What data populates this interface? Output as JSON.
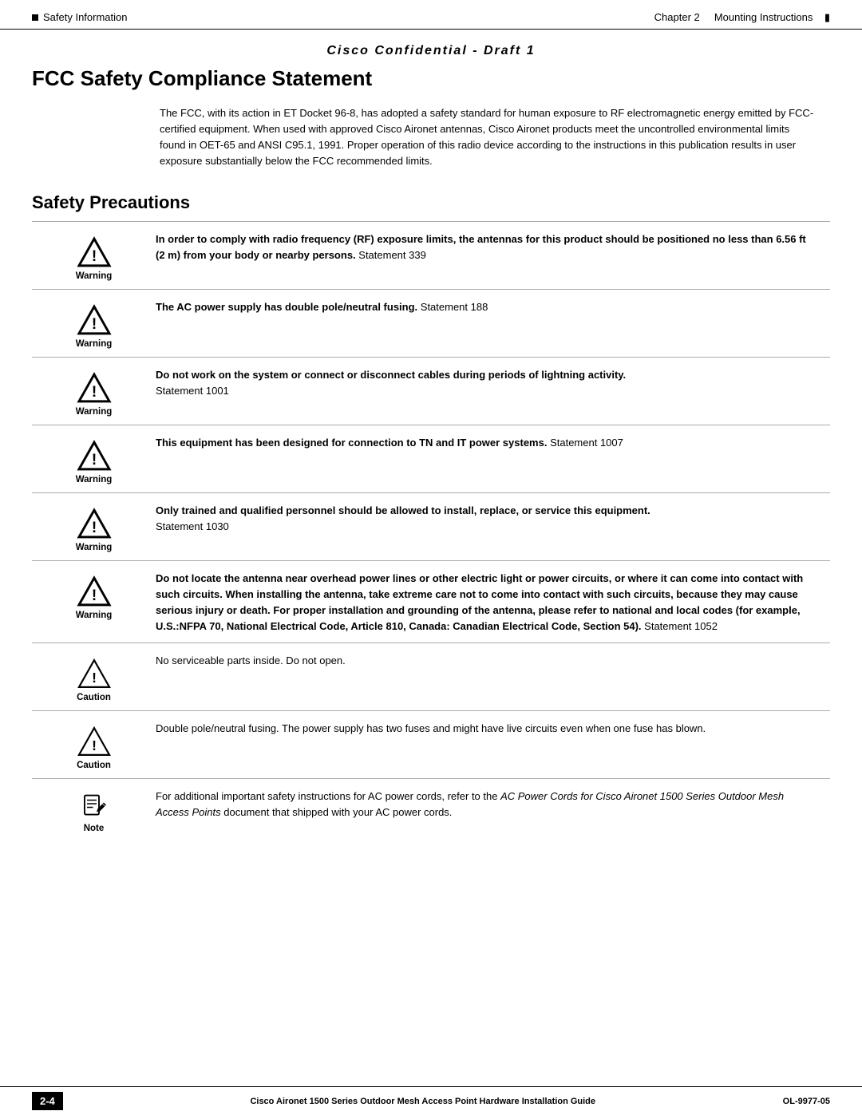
{
  "header": {
    "left_label": "Safety Information",
    "chapter_label": "Chapter 2",
    "section_label": "Mounting Instructions"
  },
  "confidential": "Cisco Confidential - Draft 1",
  "page_title": "FCC Safety Compliance Statement",
  "intro": "The FCC, with its action in ET Docket 96-8, has adopted a safety standard for human exposure to RF electromagnetic energy emitted by FCC-certified equipment. When used with approved Cisco Aironet antennas, Cisco Aironet products meet the uncontrolled environmental limits found in OET-65 and ANSI C95.1, 1991. Proper operation of this radio device according to the instructions in this publication results in user exposure substantially below the FCC recommended limits.",
  "safety_section_title": "Safety Precautions",
  "notices": [
    {
      "type": "Warning",
      "text_bold": "In order to comply with radio frequency (RF) exposure limits, the antennas for this product should be positioned no less than 6.56 ft (2 m) from your body or nearby persons.",
      "text_normal": " Statement 339"
    },
    {
      "type": "Warning",
      "text_bold": "The AC power supply has double pole/neutral fusing.",
      "text_normal": " Statement 188"
    },
    {
      "type": "Warning",
      "text_bold": "Do not work on the system or connect or disconnect cables during periods of lightning activity.",
      "text_normal": "\nStatement 1001"
    },
    {
      "type": "Warning",
      "text_bold": "This equipment has been designed for connection to TN and IT power systems.",
      "text_normal": " Statement 1007"
    },
    {
      "type": "Warning",
      "text_bold": "Only trained and qualified personnel should be allowed to install, replace, or service this equipment.",
      "text_normal": "\nStatement 1030"
    },
    {
      "type": "Warning",
      "text_bold": "Do not locate the antenna near overhead power lines or other electric light or power circuits, or where it can come into contact with such circuits. When installing the antenna, take extreme care not to come into contact with such circuits, because they may cause serious injury or death. For proper installation and grounding of the antenna, please refer to national and local codes (for example, U.S.:NFPA 70, National Electrical Code, Article 810, Canada: Canadian Electrical Code, Section 54).",
      "text_normal": " Statement 1052"
    },
    {
      "type": "Caution",
      "text_normal": "No serviceable parts inside. Do not open."
    },
    {
      "type": "Caution",
      "text_normal": "Double pole/neutral fusing. The power supply has two fuses and might have live circuits even when one fuse has blown."
    },
    {
      "type": "Note",
      "text_normal": "For additional important safety instructions for AC power cords, refer to the ",
      "text_italic1": "AC Power Cords for Cisco Aironet 1500 Series Outdoor Mesh Access Points",
      "text_italic2": " document that shipped with your AC power cords."
    }
  ],
  "footer": {
    "page_num": "2-4",
    "center_text": "Cisco Aironet 1500 Series Outdoor Mesh Access Point Hardware Installation Guide",
    "right_text": "OL-9977-05"
  }
}
